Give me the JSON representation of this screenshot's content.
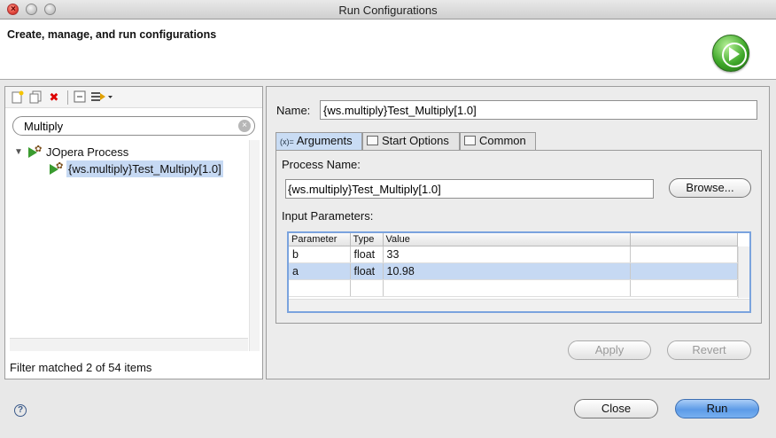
{
  "window": {
    "title": "Run Configurations"
  },
  "header": {
    "title": "Create, manage, and run configurations"
  },
  "left": {
    "search": {
      "value": "Multiply"
    },
    "tree": {
      "group": "JOpera Process",
      "item": "{ws.multiply}Test_Multiply[1.0]"
    },
    "status": "Filter matched 2 of 54 items"
  },
  "right": {
    "name_label": "Name:",
    "name_value": "{ws.multiply}Test_Multiply[1.0]",
    "tabs": [
      {
        "label": "Arguments",
        "glyph": "(x)="
      },
      {
        "label": "Start Options"
      },
      {
        "label": "Common"
      }
    ],
    "process_name_label": "Process Name:",
    "process_name_value": "{ws.multiply}Test_Multiply[1.0]",
    "browse_label": "Browse...",
    "input_params_label": "Input Parameters:",
    "table": {
      "columns": [
        "Parameter",
        "Type",
        "Value"
      ],
      "rows": [
        {
          "parameter": "b",
          "type": "float",
          "value": "33"
        },
        {
          "parameter": "a",
          "type": "float",
          "value": "10.98"
        }
      ]
    },
    "apply_label": "Apply",
    "revert_label": "Revert"
  },
  "footer": {
    "close_label": "Close",
    "run_label": "Run"
  },
  "colors": {
    "selection": "#c6d9f3",
    "run_button": "#5d9be7",
    "run_icon": "#3fa82a"
  }
}
